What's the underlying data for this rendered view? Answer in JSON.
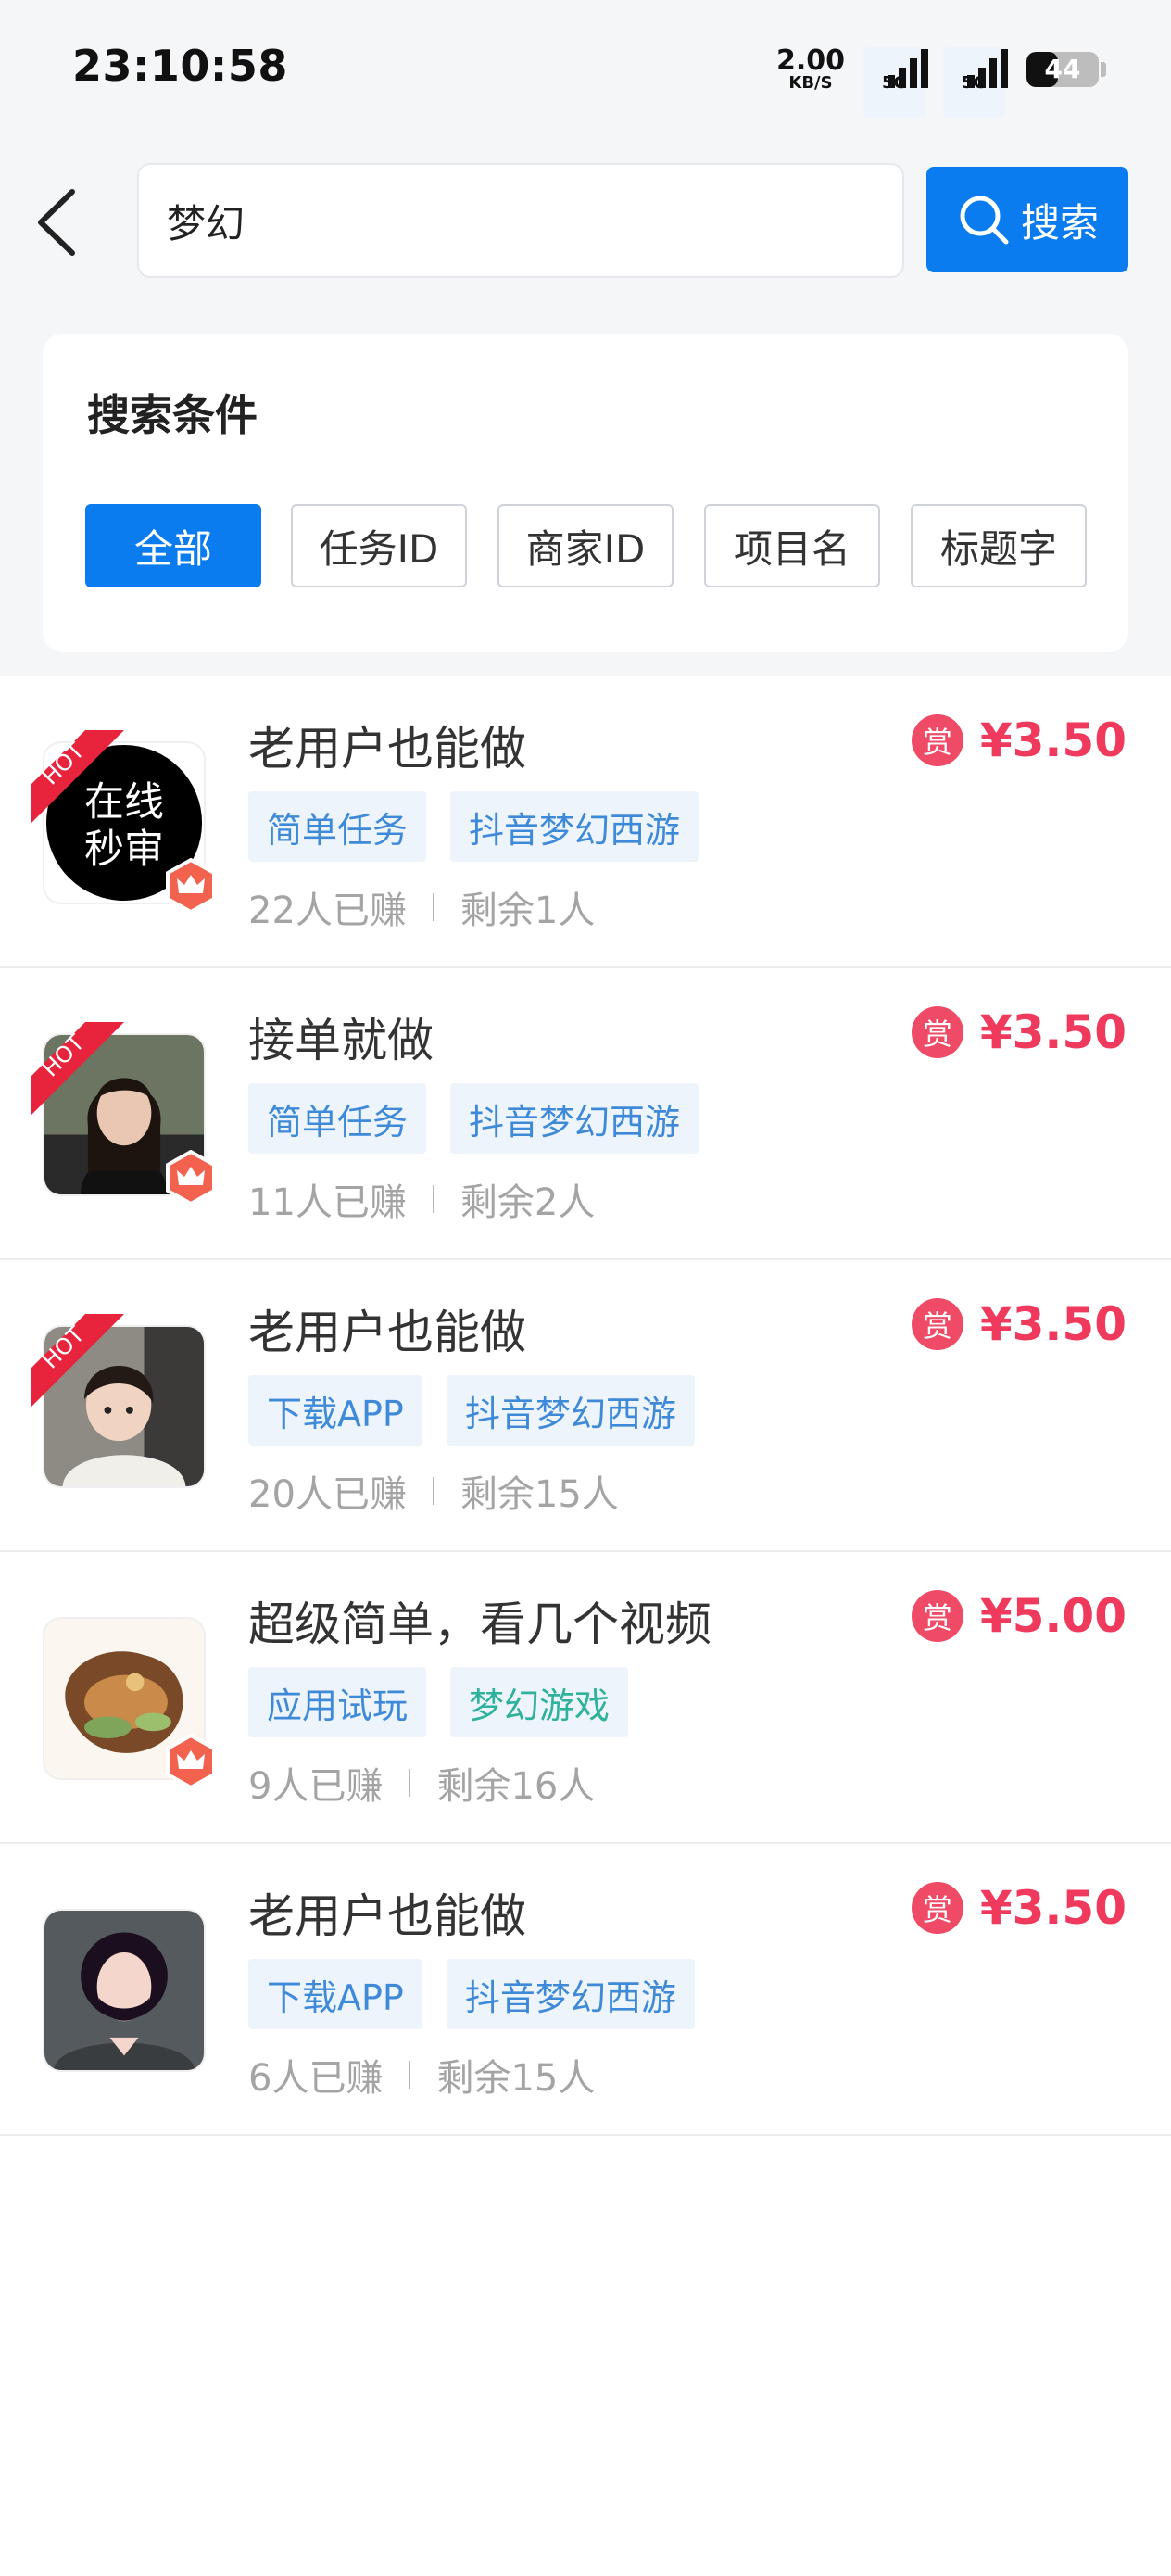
{
  "status_bar": {
    "time": "23:10:58",
    "net_speed_value": "2.00",
    "net_speed_unit": "KB/S",
    "signal_1_label": "5G",
    "signal_2_label": "5G",
    "battery_level": "44"
  },
  "header": {
    "search_value": "梦幻",
    "search_button_label": "搜索"
  },
  "filter": {
    "title": "搜索条件",
    "chips": [
      "全部",
      "任务ID",
      "商家ID",
      "项目名",
      "标题字"
    ],
    "active_index": 0
  },
  "tasks": [
    {
      "title": "老用户也能做",
      "tags": [
        {
          "label": "简单任务",
          "color": "blue"
        },
        {
          "label": "抖音梦幻西游",
          "color": "blue"
        }
      ],
      "earned": "22人已赚",
      "remaining": "剩余1人",
      "reward_icon": "赏",
      "reward": "¥3.50",
      "hot": true,
      "crown": true,
      "avatar_text_1": "在线",
      "avatar_text_2": "秒审"
    },
    {
      "title": "接单就做",
      "tags": [
        {
          "label": "简单任务",
          "color": "blue"
        },
        {
          "label": "抖音梦幻西游",
          "color": "blue"
        }
      ],
      "earned": "11人已赚",
      "remaining": "剩余2人",
      "reward_icon": "赏",
      "reward": "¥3.50",
      "hot": true,
      "crown": true
    },
    {
      "title": "老用户也能做",
      "tags": [
        {
          "label": "下载APP",
          "color": "blue"
        },
        {
          "label": "抖音梦幻西游",
          "color": "blue"
        }
      ],
      "earned": "20人已赚",
      "remaining": "剩余15人",
      "reward_icon": "赏",
      "reward": "¥3.50",
      "hot": true,
      "crown": false
    },
    {
      "title": "超级简单，看几个视频",
      "tags": [
        {
          "label": "应用试玩",
          "color": "blue"
        },
        {
          "label": "梦幻游戏",
          "color": "green"
        }
      ],
      "earned": "9人已赚",
      "remaining": "剩余16人",
      "reward_icon": "赏",
      "reward": "¥5.00",
      "hot": false,
      "crown": true
    },
    {
      "title": "老用户也能做",
      "tags": [
        {
          "label": "下载APP",
          "color": "blue"
        },
        {
          "label": "抖音梦幻西游",
          "color": "blue"
        }
      ],
      "earned": "6人已赚",
      "remaining": "剩余15人",
      "reward_icon": "赏",
      "reward": "¥3.50",
      "hot": false,
      "crown": false
    }
  ],
  "hot_label": "HOT",
  "colors": {
    "primary": "#0a7cf0",
    "reward": "#ef3a5d",
    "tag_blue": "#3f8ad8",
    "tag_green": "#2fb29b",
    "hot_red": "#e8243c"
  }
}
